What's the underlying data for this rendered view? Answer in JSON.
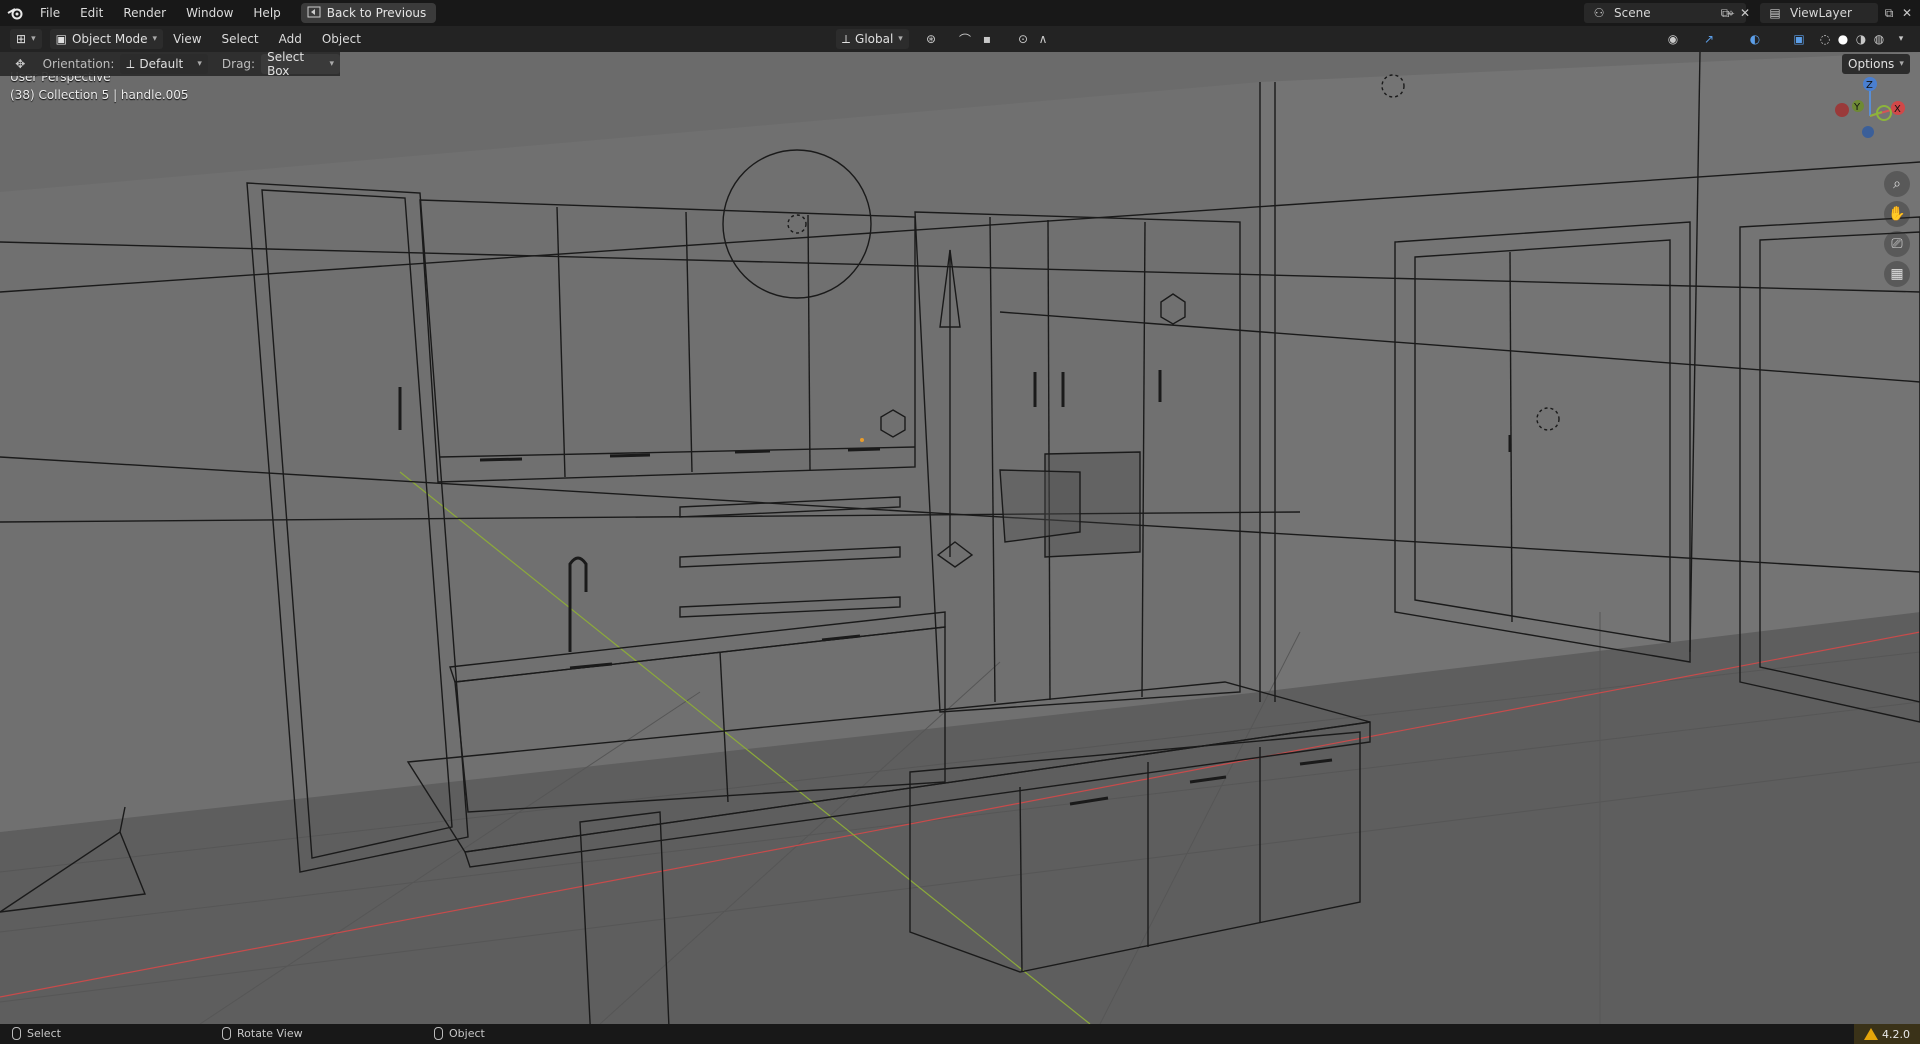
{
  "menu": {
    "items": [
      "File",
      "Edit",
      "Render",
      "Window",
      "Help"
    ],
    "back_button": "Back to Previous"
  },
  "scene": {
    "label": "Scene",
    "view_layer": "ViewLayer"
  },
  "header": {
    "mode": "Object Mode",
    "menus": [
      "View",
      "Select",
      "Add",
      "Object"
    ],
    "transform_orientation": "Global"
  },
  "tool_settings": {
    "orientation_label": "Orientation:",
    "orientation_value": "Default",
    "drag_label": "Drag:",
    "drag_value": "Select Box",
    "options_label": "Options"
  },
  "viewport": {
    "perspective_label": "User Perspective",
    "collection_label": "(38) Collection 5 | handle.005",
    "gizmo": {
      "z": "Z",
      "y": "Y",
      "x": "X"
    },
    "colors": {
      "background": "#6b6b6b",
      "wire": "#1a1a1a",
      "x_axis": "#c84b4b",
      "y_axis": "#8caa3a"
    }
  },
  "status": {
    "select": "Select",
    "rotate_view": "Rotate View",
    "object": "Object",
    "version": "4.2.0"
  },
  "icons": [
    "blender-logo",
    "back-icon",
    "scene-icon",
    "pin-icon",
    "copy-icon",
    "close-icon",
    "view-layer-icon",
    "editor-type-icon",
    "object-mode-icon",
    "global-icon",
    "pivot-icon",
    "snap-icon",
    "proportional-icon",
    "visibility-icon",
    "gizmo-icon",
    "overlay-icon",
    "xray-icon",
    "wireframe-shading-icon",
    "solid-shading-icon",
    "material-shading-icon",
    "rendered-shading-icon",
    "zoom-icon",
    "pan-icon",
    "camera-icon",
    "ortho-icon",
    "warning-icon"
  ]
}
